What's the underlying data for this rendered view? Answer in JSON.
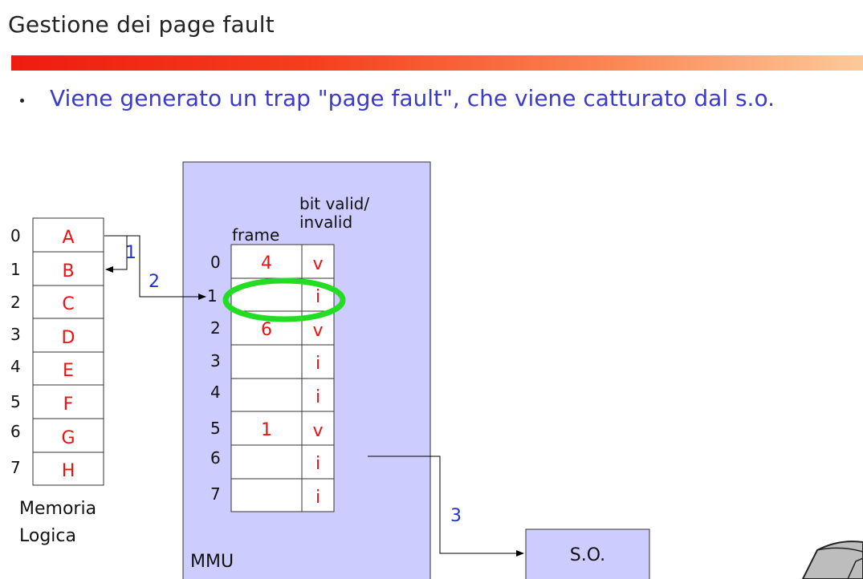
{
  "title": "Gestione dei page fault",
  "bullet": "Viene generato un trap \"page fault\", che viene catturato dal s.o.",
  "logical_memory": {
    "indices": [
      "0",
      "1",
      "2",
      "3",
      "4",
      "5",
      "6",
      "7"
    ],
    "cells": [
      "A",
      "B",
      "C",
      "D",
      "E",
      "F",
      "G",
      "H"
    ],
    "label_line1": "Memoria",
    "label_line2": "Logica"
  },
  "mmu": {
    "label": "MMU",
    "frame_header": "frame",
    "bit_header_line1": "bit valid/",
    "bit_header_line2": "invalid",
    "rows": [
      {
        "index": "0",
        "frame": "4",
        "bit": "v"
      },
      {
        "index": "1",
        "frame": "",
        "bit": "i"
      },
      {
        "index": "2",
        "frame": "6",
        "bit": "v"
      },
      {
        "index": "3",
        "frame": "",
        "bit": "i"
      },
      {
        "index": "4",
        "frame": "",
        "bit": "i"
      },
      {
        "index": "5",
        "frame": "1",
        "bit": "v"
      },
      {
        "index": "6",
        "frame": "",
        "bit": "i"
      },
      {
        "index": "7",
        "frame": "",
        "bit": "i"
      }
    ]
  },
  "steps": [
    "1",
    "2",
    "3"
  ],
  "os_box": "S.O.",
  "colors": {
    "mmu_fill": "#ccccff",
    "cell_text": "#ee1111",
    "step_text": "#2233cc",
    "highlight": "#22dd22"
  }
}
